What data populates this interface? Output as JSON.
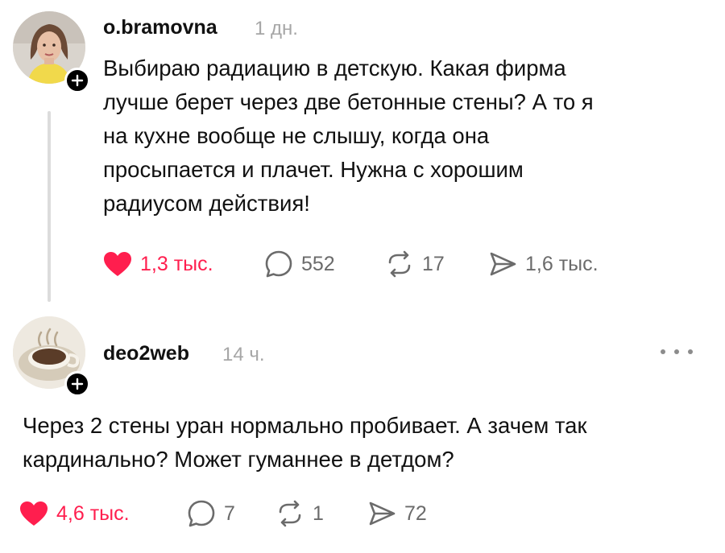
{
  "posts": [
    {
      "username": "o.bramovna",
      "time": "1 дн.",
      "avatar_icon": "user-photo-icon",
      "text_lines": [
        "Выбираю радиацию в детскую. Какая фирма",
        "лучше берет через две бетонные стены? А то я",
        "на кухне вообще не слышу, когда она",
        "просыпается и плачет. Нужна с хорошим",
        "радиусом действия!"
      ],
      "likes": "1,3 тыс.",
      "replies": "552",
      "reposts": "17",
      "shares": "1,6 тыс.",
      "liked": true
    },
    {
      "username": "deo2web",
      "time": "14 ч.",
      "avatar_icon": "coffee-cup-icon",
      "text_lines": [
        "Через 2 стены уран нормально пробивает. А зачем так",
        "кардинально? Может гуманнее в детдом?"
      ],
      "likes": "4,6 тыс.",
      "replies": "7",
      "reposts": "1",
      "shares": "72",
      "liked": true
    }
  ],
  "colors": {
    "like_active": "#ff1e4e",
    "muted_text": "#a6a6a6",
    "icon_gray": "#6b6b6b",
    "thread_line": "#dcdcdc"
  }
}
